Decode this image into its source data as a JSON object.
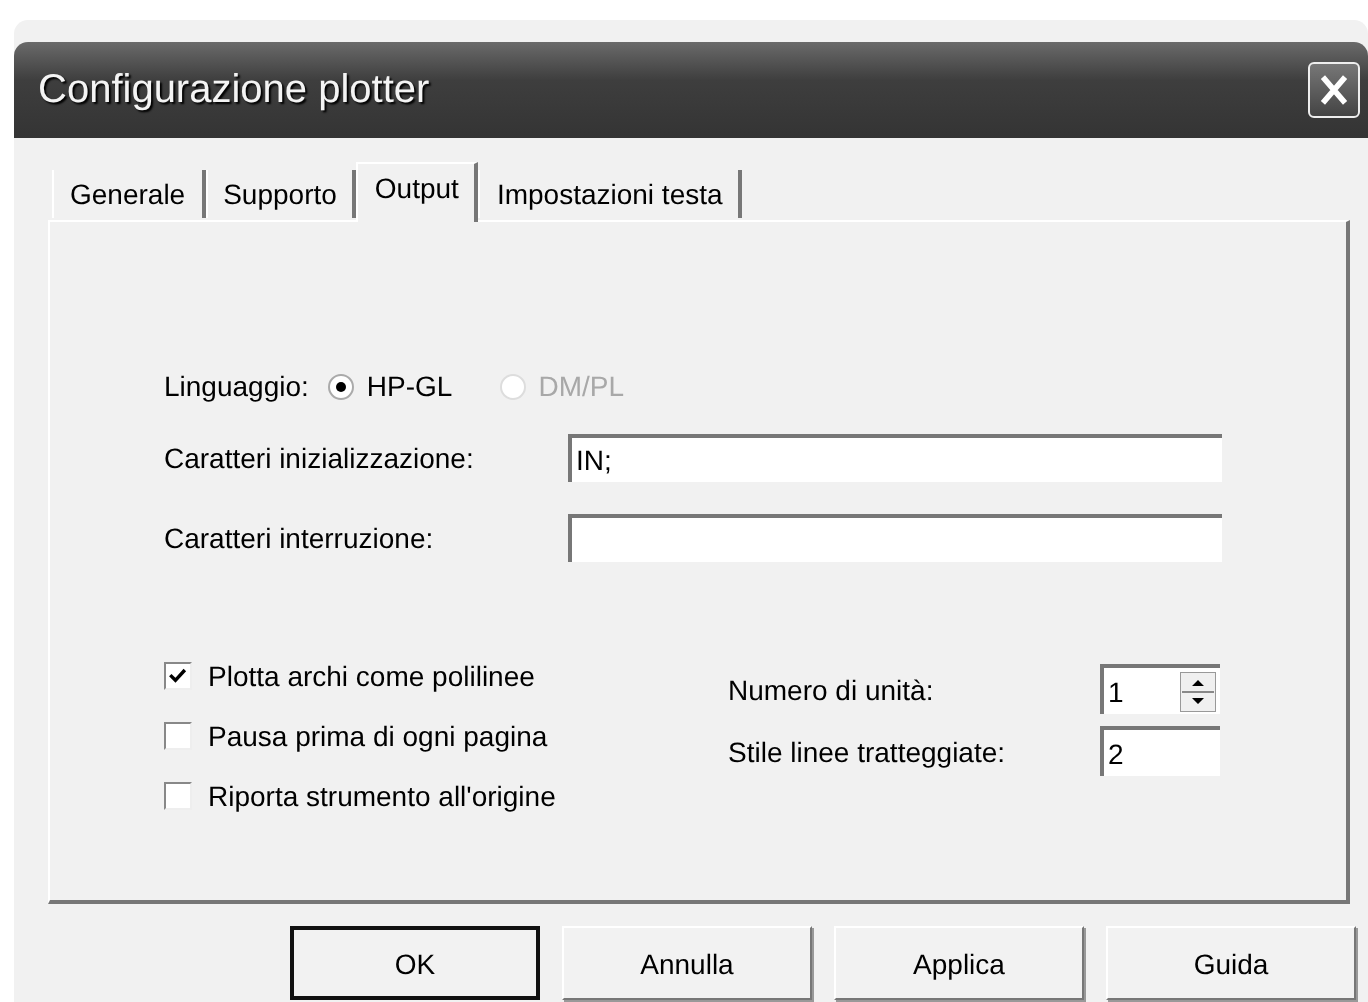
{
  "window": {
    "title": "Configurazione plotter"
  },
  "tabs": [
    {
      "label": "Generale",
      "selected": false
    },
    {
      "label": "Supporto",
      "selected": false
    },
    {
      "label": "Output",
      "selected": true
    },
    {
      "label": "Impostazioni testa",
      "selected": false
    }
  ],
  "language": {
    "label": "Linguaggio:",
    "options": [
      {
        "label": "HP-GL",
        "selected": true,
        "disabled": false
      },
      {
        "label": "DM/PL",
        "selected": false,
        "disabled": true
      }
    ]
  },
  "fields": [
    {
      "label": "Caratteri inizializzazione:",
      "value": "IN;"
    },
    {
      "label": "Caratteri interruzione:"
    }
  ],
  "checkboxes": [
    {
      "label": "Plotta archi come polilinee",
      "checked": true
    },
    {
      "label": "Pausa prima di ogni pagina",
      "checked": false
    },
    {
      "label": "Riporta strumento all'origine",
      "checked": false
    }
  ],
  "unit_number": {
    "label": "Numero di unità:",
    "value": "1"
  },
  "dash_style": {
    "label": "Stile linee tratteggiate:",
    "value": "2"
  },
  "buttons": [
    {
      "label": "OK",
      "default": true
    },
    {
      "label": "Annulla",
      "default": false
    },
    {
      "label": "Applica",
      "default": false
    },
    {
      "label": "Guida",
      "default": false
    }
  ]
}
